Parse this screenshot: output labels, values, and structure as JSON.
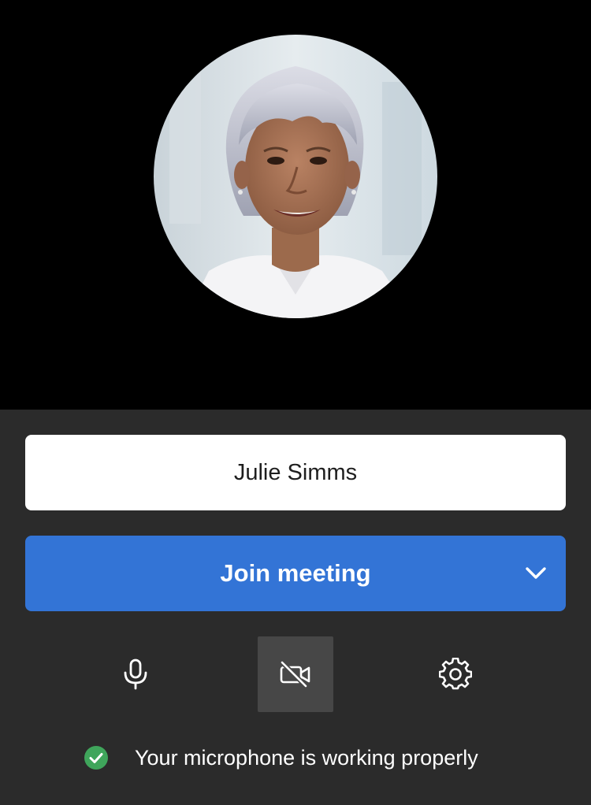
{
  "preview": {
    "avatar_icon": "user-photo",
    "background_color": "#000000"
  },
  "form": {
    "name_value": "Julie Simms",
    "name_placeholder": ""
  },
  "join": {
    "label": "Join meeting",
    "color": "#3374d6",
    "options_icon": "chevron-down-icon"
  },
  "controls": {
    "microphone": {
      "icon": "microphone-icon",
      "state": "on"
    },
    "camera": {
      "icon": "camera-off-icon",
      "state": "off"
    },
    "settings": {
      "icon": "gear-icon"
    }
  },
  "status": {
    "icon": "check-circle-icon",
    "icon_color": "#3fa55b",
    "text": "Your microphone is working properly"
  },
  "colors": {
    "panel_background": "#2b2b2b",
    "active_control_background": "#474747"
  }
}
